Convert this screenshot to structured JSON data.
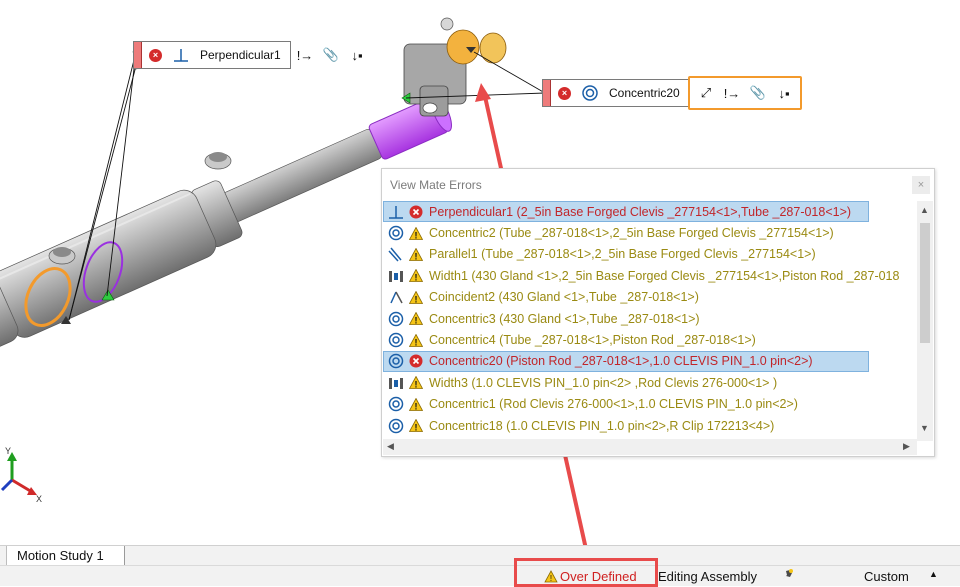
{
  "graphics_area": {
    "triad": {
      "y_label": "Y",
      "x_label": "X"
    },
    "callouts": [
      {
        "name": "Perpendicular1",
        "mate_type": "perpendicular",
        "status": "error"
      },
      {
        "name": "Concentric20",
        "mate_type": "concentric",
        "status": "error"
      }
    ],
    "callout_tools": [
      "flip-alignment",
      "next-error",
      "attach",
      "sort"
    ]
  },
  "mate_errors_dialog": {
    "title": "View Mate Errors",
    "close_label": "×",
    "rows": [
      {
        "mate_type": "perpendicular",
        "status": "error",
        "text": "Perpendicular1 (2_5in Base Forged Clevis _277154<1>,Tube _287-018<1>)"
      },
      {
        "mate_type": "concentric",
        "status": "warning",
        "text": "Concentric2 (Tube _287-018<1>,2_5in Base Forged Clevis _277154<1>)"
      },
      {
        "mate_type": "parallel",
        "status": "warning",
        "text": "Parallel1 (Tube _287-018<1>,2_5in Base Forged Clevis _277154<1>)"
      },
      {
        "mate_type": "width",
        "status": "warning",
        "text": "Width1 (430 Gland <1>,2_5in Base Forged Clevis _277154<1>,Piston Rod _287-018"
      },
      {
        "mate_type": "coincident",
        "status": "warning",
        "text": "Coincident2 (430 Gland <1>,Tube _287-018<1>)"
      },
      {
        "mate_type": "concentric",
        "status": "warning",
        "text": "Concentric3 (430 Gland <1>,Tube _287-018<1>)"
      },
      {
        "mate_type": "concentric",
        "status": "warning",
        "text": "Concentric4 (Tube _287-018<1>,Piston Rod _287-018<1>)"
      },
      {
        "mate_type": "concentric",
        "status": "error",
        "text": "Concentric20 (Piston Rod _287-018<1>,1.0 CLEVIS PIN_1.0 pin<2>)"
      },
      {
        "mate_type": "width",
        "status": "warning",
        "text": "Width3 (1.0 CLEVIS PIN_1.0 pin<2> ,Rod Clevis 276-000<1> )"
      },
      {
        "mate_type": "concentric",
        "status": "warning",
        "text": "Concentric1 (Rod Clevis 276-000<1>,1.0 CLEVIS PIN_1.0 pin<2>)"
      },
      {
        "mate_type": "concentric",
        "status": "warning",
        "text": "Concentric18 (1.0 CLEVIS PIN_1.0 pin<2>,R Clip 172213<4>)"
      }
    ]
  },
  "bottom_tabs": [
    {
      "label": "Motion Study 1"
    }
  ],
  "status_bar": {
    "over_defined": "Over Defined",
    "editing": "Editing Assembly",
    "units": "Custom",
    "caret": "▲"
  },
  "colors": {
    "error": "#c1262a",
    "warning": "#9a8a12",
    "selection": "#bcd9f0",
    "highlight_orange": "#f39a2c",
    "annotation_red": "#e84b4b",
    "selected_part": "#c252ff"
  }
}
